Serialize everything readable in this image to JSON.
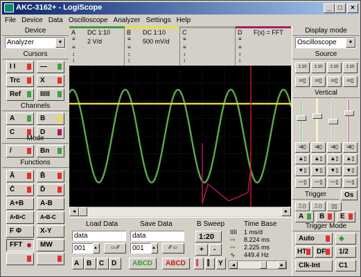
{
  "window": {
    "title": "AKC-3162+ - LogiScope"
  },
  "menu": [
    "File",
    "Device",
    "Data",
    "Oscilloscope",
    "Analyzer",
    "Settings",
    "Help"
  ],
  "left": {
    "device_header": "Device",
    "device_select": "Analyzer",
    "cursors_header": "Cursors",
    "cursor_buttons": [
      "I I",
      "—",
      "Trc",
      "X",
      "Ref",
      "IIIII"
    ],
    "channels_header": "Channels",
    "channel_buttons": [
      "A",
      "B",
      "C",
      "D"
    ],
    "mode_header": "Mode",
    "mode_buttons": [
      "/",
      "Bn"
    ],
    "functions_header": "Functions",
    "function_buttons": [
      "Ā",
      "B̄",
      "C̄",
      "D̄",
      "A+B",
      "A-B",
      "A•B•C",
      "A•B-C",
      "F Φ",
      "X-Y",
      "FFT",
      "MW"
    ]
  },
  "channels": [
    {
      "name": "A",
      "setting": "DC 1:10",
      "value": "2 V/d",
      "color": "#3e9a3e"
    },
    {
      "name": "B",
      "setting": "DC 1:10",
      "value": "500 mV/d",
      "color": "#e8e040"
    },
    {
      "name": "C",
      "setting": "",
      "value": "",
      "color": "#a0a0a0"
    },
    {
      "name": "D",
      "setting": "F(x) = FFT",
      "value": "",
      "color": "#b01860"
    }
  ],
  "chart_data": {
    "type": "line",
    "series": [
      {
        "name": "A",
        "description": "sine wave",
        "color": "#5aa64a",
        "periods": 4.2
      },
      {
        "name": "B",
        "description": "flat line",
        "color": "#e8d820"
      },
      {
        "name": "D",
        "description": "FFT spectrum",
        "color": "#b01860"
      }
    ]
  },
  "bottom": {
    "load_header": "Load Data",
    "load_name": "data",
    "load_index": "001",
    "save_header": "Save Data",
    "save_name": "data",
    "save_index": "001",
    "channel_row": [
      "A",
      "B",
      "C",
      "D"
    ],
    "abcd_green": "ABCD",
    "abcd_red": "ABCD",
    "sweep_header": "B Sweep",
    "sweep_value": "1:20",
    "plus": "+",
    "minus": "-",
    "timebase_header": "Time Base",
    "tb_values": [
      "1 ms/d",
      "8.224 ms",
      "2.225 ms",
      "449.4 Hz"
    ]
  },
  "right": {
    "display_header": "Display mode",
    "display_select": "Oscilloscope",
    "source_header": "Source",
    "source_buttons": [
      "1:10",
      "1:10",
      "1:10",
      "1:10"
    ],
    "vertical_header": "Vertical",
    "trigger_header": "Trigger",
    "os": "Os",
    "trig_buttons": [
      "A",
      "B",
      "E"
    ],
    "trigger_mode_header": "Trigger Mode",
    "auto": "Auto",
    "ht": "HT",
    "df": "DF",
    "half": "1/2",
    "clk": "Clk-Int",
    "c1": "C1"
  }
}
